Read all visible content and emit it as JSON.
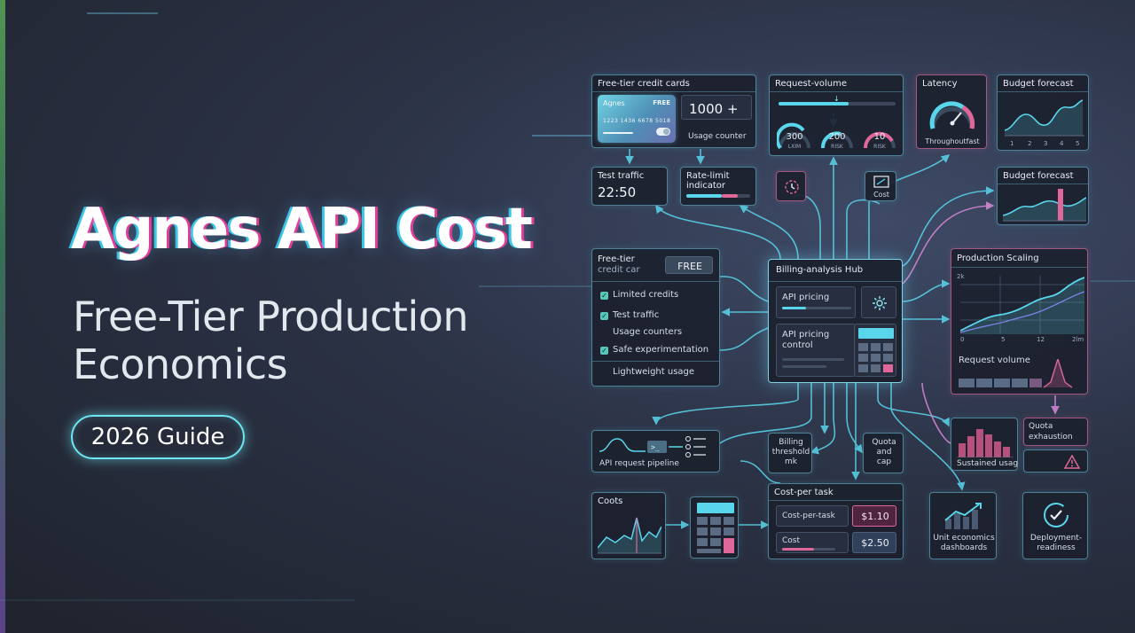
{
  "hero": {
    "title": "Agnes API Cost",
    "subtitle_line1": "Free-Tier Production",
    "subtitle_line2": "Economics",
    "guide": "2026 Guide"
  },
  "panels": {
    "free_tier_cards": {
      "title": "Free-tier credit cards",
      "card_name": "Agnes",
      "card_badge": "FREE",
      "card_number": "1223 1436 6678 5018",
      "counter": "1000 +",
      "counter_label": "Usage counter"
    },
    "test_traffic": {
      "title": "Test traffic",
      "value": "22:50"
    },
    "rate_limit": {
      "title_line1": "Rate-limit",
      "title_line2": "indicator",
      "fill": 0.55
    },
    "request_volume": {
      "title": "Request-volume",
      "fill": 0.6,
      "gauges": [
        {
          "value": "300",
          "label": "LXIM"
        },
        {
          "value": "200",
          "label": "RISK"
        },
        {
          "value": "10",
          "label": "RISK"
        }
      ]
    },
    "cost_small": {
      "label": "Cost"
    },
    "latency": {
      "title": "Latency",
      "label": "Throughoutfast"
    },
    "budget_forecast_1": {
      "title": "Budget forecast",
      "ticks": [
        "1",
        "2",
        "3",
        "4",
        "5"
      ]
    },
    "budget_forecast_2": {
      "title": "Budget forecast"
    },
    "free_tier_list": {
      "title_line1": "Free-tier",
      "title_line2": "credit car",
      "badge": "FREE",
      "items": [
        {
          "label": "Limited credits",
          "checked": true
        },
        {
          "label": "Test traffic",
          "checked": true
        },
        {
          "label": "Usage counters",
          "checked": false
        },
        {
          "label": "Safe experimentation",
          "checked": true
        },
        {
          "label": "Lightweight usage",
          "checked": false
        }
      ]
    },
    "hub": {
      "title": "Billing-analysis Hub",
      "item1": "API pricing",
      "item2_line1": "API pricing",
      "item2_line2": "control"
    },
    "production_scaling": {
      "title": "Production Scaling",
      "y_top": "2k",
      "x_ticks": [
        "0",
        "5",
        "12",
        "2lm"
      ],
      "request_volume": "Request volume"
    },
    "pipeline": {
      "label": "API request pipeline"
    },
    "billing_threshold": {
      "line1": "Billing",
      "line2": "threshold",
      "line3": "mk"
    },
    "quota_cap": {
      "line1": "Quota",
      "line2": "and",
      "line3": "cap"
    },
    "sustained": {
      "label": "Sustained usag"
    },
    "quota_exhaustion": {
      "line1": "Quota",
      "line2": "exhaustion"
    },
    "costs": {
      "title": "Coots"
    },
    "cost_per_task": {
      "title": "Cost-per task",
      "row1_label": "Cost-per-task",
      "row1_value": "$1.10",
      "row2_label": "Cost",
      "row2_value": "$2.50"
    },
    "unit_economics": {
      "line1": "Unit economics",
      "line2": "dashboards"
    },
    "deployment": {
      "line1": "Deployment-",
      "line2": "readiness"
    }
  },
  "colors": {
    "cyan": "#5ad6ec",
    "pink": "#e0679a",
    "accent_border": "#78d2eb"
  }
}
